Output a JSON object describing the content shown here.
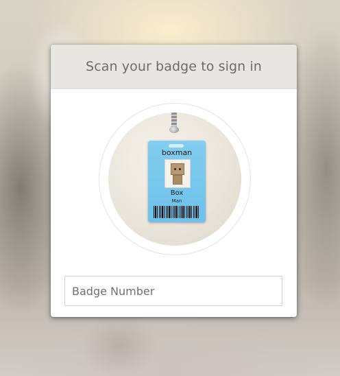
{
  "header": {
    "title": "Scan your badge to sign in"
  },
  "badge_image": {
    "name": "boxman",
    "first": "Box",
    "last": "Man",
    "card_color": "#75c5ec"
  },
  "form": {
    "badge_number_placeholder": "Badge Number",
    "badge_number_value": ""
  }
}
